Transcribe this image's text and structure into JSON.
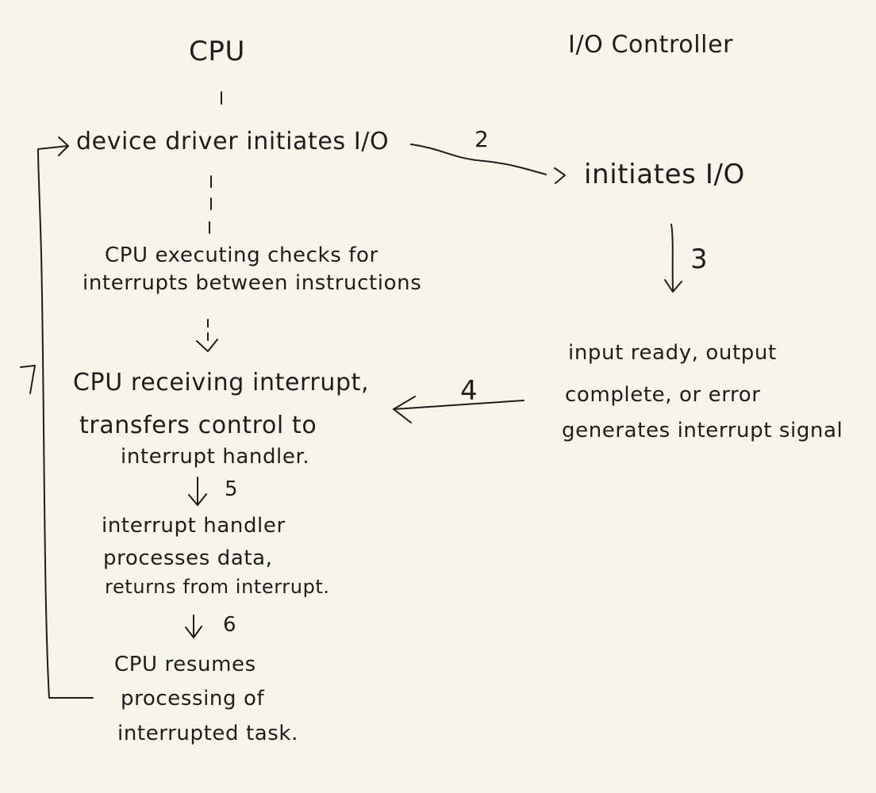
{
  "headers": {
    "cpu": "CPU",
    "io_controller": "I/O Controller"
  },
  "cpu_steps": {
    "s1": "device driver initiates I/O",
    "s2_line1": "CPU executing checks for",
    "s2_line2": "interrupts between instructions",
    "s3_line1": "CPU receiving interrupt,",
    "s3_line2": "transfers control to",
    "s3_line3": "interrupt handler.",
    "s4_line1": "interrupt handler",
    "s4_line2": "processes data,",
    "s4_line3": "returns from interrupt.",
    "s5_line1": "CPU resumes",
    "s5_line2": "processing of",
    "s5_line3": "interrupted task."
  },
  "io_steps": {
    "s1": "initiates I/O",
    "s2_line1": "input ready, output",
    "s2_line2": "complete, or error",
    "s2_line3": "generates interrupt signal"
  },
  "step_numbers": {
    "n2": "2",
    "n3": "3",
    "n4": "4",
    "n5": "5",
    "n6": "6",
    "n7": "7"
  }
}
